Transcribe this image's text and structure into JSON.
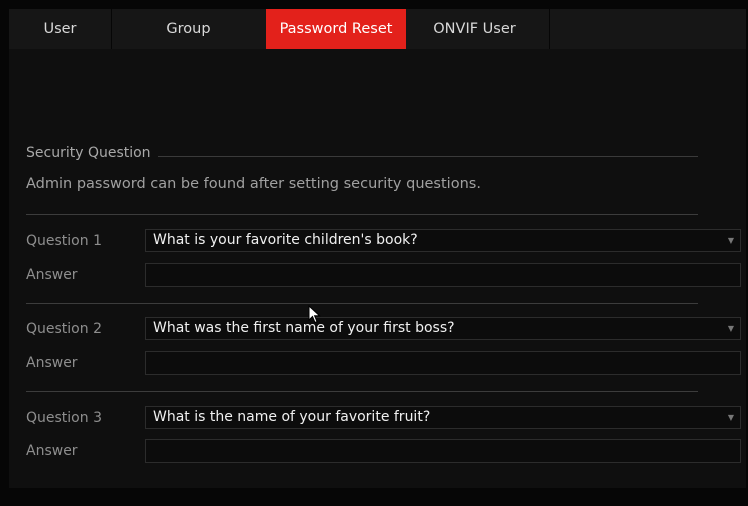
{
  "tabs": [
    {
      "label": "User"
    },
    {
      "label": "Group"
    },
    {
      "label": "Password Reset"
    },
    {
      "label": "ONVIF User"
    }
  ],
  "section": {
    "title": "Security Question",
    "hint": "Admin password can be found after setting security questions."
  },
  "questions": [
    {
      "label": "Question 1",
      "value": "What is your favorite children's book?",
      "answer_label": "Answer",
      "answer": ""
    },
    {
      "label": "Question 2",
      "value": "What was the first name of your first boss?",
      "answer_label": "Answer",
      "answer": ""
    },
    {
      "label": "Question 3",
      "value": "What is the name of your favorite fruit?",
      "answer_label": "Answer",
      "answer": ""
    }
  ],
  "icons": {
    "dropdown": "chevron-down-icon",
    "pointer": "mouse-pointer-icon"
  },
  "colors": {
    "accent": "#e3211b",
    "background": "#0f0f0f"
  }
}
